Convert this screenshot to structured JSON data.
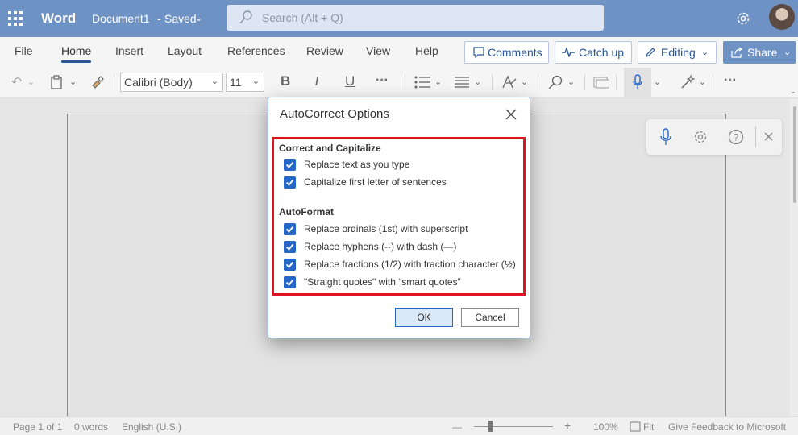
{
  "titlebar": {
    "app_name": "Word",
    "document_name": "Document1",
    "separator": "-",
    "save_status": "Saved",
    "search_placeholder": "Search (Alt + Q)"
  },
  "ribbon": {
    "tabs": [
      "File",
      "Home",
      "Insert",
      "Layout",
      "References",
      "Review",
      "View",
      "Help"
    ],
    "active_tab": "Home",
    "comments_label": "Comments",
    "catchup_label": "Catch up",
    "editing_label": "Editing",
    "share_label": "Share"
  },
  "toolbar": {
    "font_name": "Calibri (Body)",
    "font_size": "11",
    "more_glyph": "···"
  },
  "dialog": {
    "title": "AutoCorrect Options",
    "section1_title": "Correct and Capitalize",
    "section1_options": [
      {
        "label": "Replace text as you type",
        "checked": true
      },
      {
        "label": "Capitalize first letter of sentences",
        "checked": true
      }
    ],
    "section2_title": "AutoFormat",
    "section2_options": [
      {
        "label": "Replace ordinals (1st) with superscript",
        "checked": true
      },
      {
        "label": "Replace hyphens (--) with dash (—)",
        "checked": true
      },
      {
        "label": "Replace fractions (1/2) with fraction character (½)",
        "checked": true
      },
      {
        "label": "\"Straight quotes\" with “smart quotes”",
        "checked": true
      }
    ],
    "ok_label": "OK",
    "cancel_label": "Cancel"
  },
  "statusbar": {
    "page": "Page 1 of 1",
    "words": "0 words",
    "language": "English (U.S.)",
    "zoom_minus": "—",
    "zoom_plus": "+",
    "zoom_level": "100%",
    "fit_label": "Fit",
    "feedback": "Give Feedback to Microsoft"
  },
  "colors": {
    "accent": "#6f92c5",
    "highlight_border": "#e0141e",
    "checkbox": "#2566c7"
  }
}
